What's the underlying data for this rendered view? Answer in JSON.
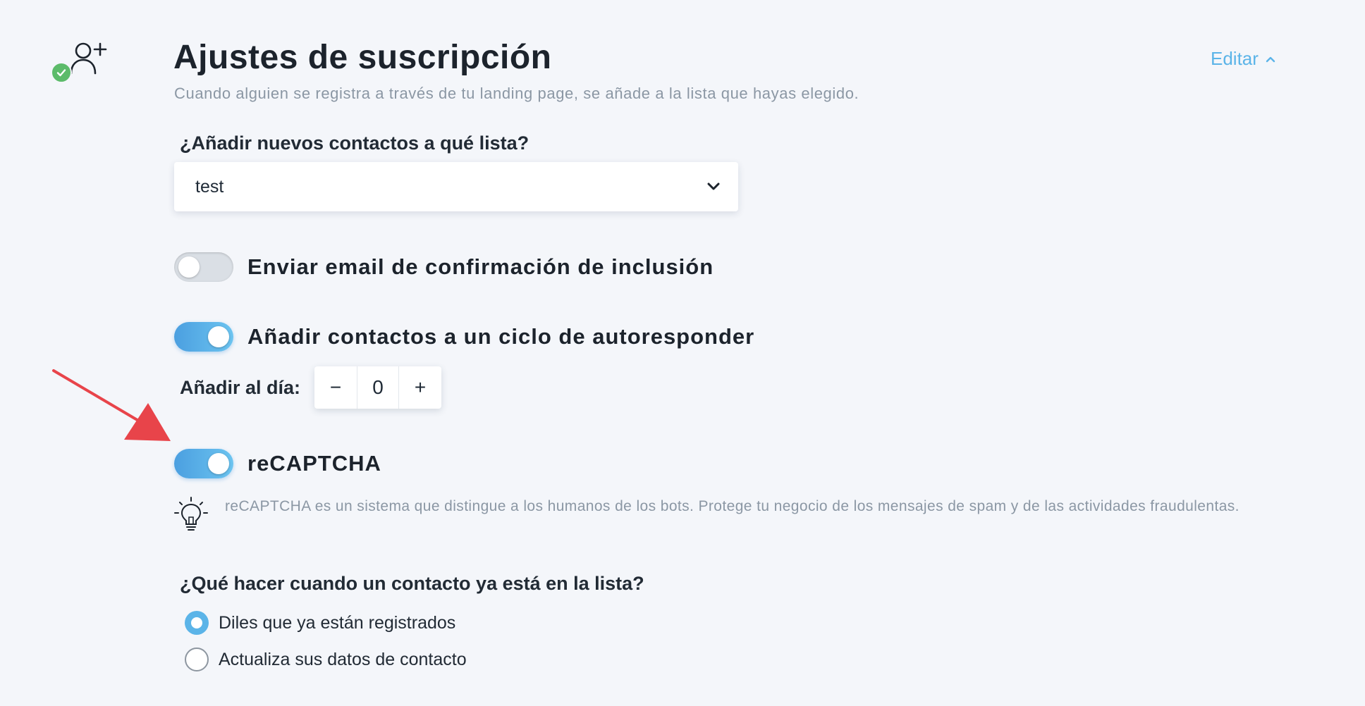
{
  "header": {
    "title": "Ajustes de suscripción",
    "subtitle": "Cuando alguien se registra a través de tu landing page, se añade a la lista que hayas elegido.",
    "edit_label": "Editar",
    "icon": "user-plus-icon",
    "status_icon": "check-circle-icon"
  },
  "list": {
    "question": "¿Añadir nuevos contactos a qué lista?",
    "selected": "test"
  },
  "toggles": {
    "confirmation": {
      "label": "Enviar email de confirmación de inclusión",
      "on": false
    },
    "autoresponder": {
      "label": "Añadir contactos a un ciclo de autoresponder",
      "on": true
    },
    "recaptcha": {
      "label": "reCAPTCHA",
      "on": true
    }
  },
  "day": {
    "label": "Añadir al día:",
    "minus": "−",
    "value": "0",
    "plus": "+"
  },
  "hint": {
    "icon": "lightbulb-icon",
    "text": "reCAPTCHA es un sistema que distingue a los humanos de los bots. Protege tu negocio de los mensajes de spam y de las actividades fraudulentas."
  },
  "existing": {
    "question": "¿Qué hacer cuando un contacto ya está en la lista?",
    "options": [
      {
        "label": "Diles que ya están registrados",
        "checked": true
      },
      {
        "label": "Actualiza sus datos de contacto",
        "checked": false
      }
    ]
  },
  "colors": {
    "accent": "#5bb4e8",
    "success": "#5cbb6a",
    "annotation_arrow": "#e8444a"
  }
}
